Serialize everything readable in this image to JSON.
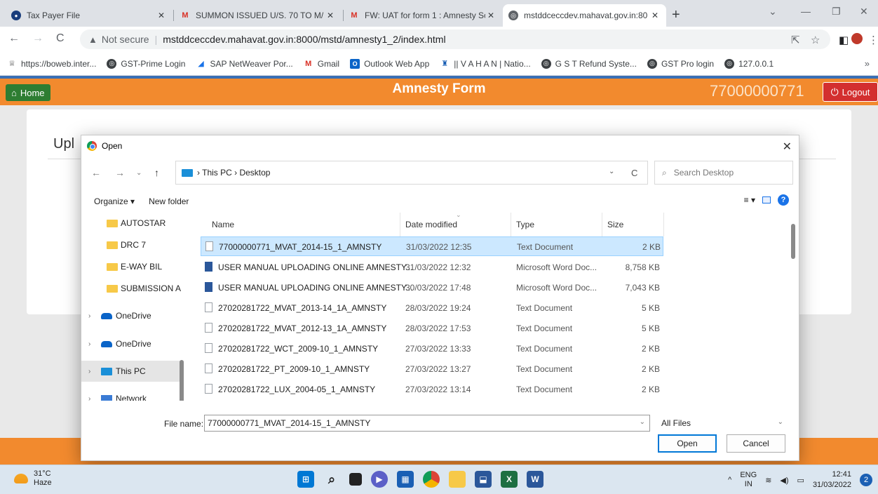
{
  "browser": {
    "tabs": [
      {
        "title": "Tax Payer File",
        "icon": "site-icon",
        "active": false
      },
      {
        "title": "SUMMON ISSUED U/S. 70 TO M/",
        "icon": "gmail-icon",
        "active": false
      },
      {
        "title": "FW: UAT for form 1 : Amnesty Sc",
        "icon": "gmail-icon",
        "active": false
      },
      {
        "title": "mstddceccdev.mahavat.gov.in:80",
        "icon": "globe-icon",
        "active": true
      }
    ],
    "address": {
      "security": "Not secure",
      "url": "mstddceccdev.mahavat.gov.in:8000/mstd/amnesty1_2/index.html"
    },
    "bookmarks": [
      {
        "label": "https://boweb.inter...",
        "icon": "emblem-icon"
      },
      {
        "label": "GST-Prime Login",
        "icon": "globe-icon"
      },
      {
        "label": "SAP NetWeaver Por...",
        "icon": "sap-icon"
      },
      {
        "label": "Gmail",
        "icon": "gmail-icon"
      },
      {
        "label": "Outlook Web App",
        "icon": "outlook-icon"
      },
      {
        "label": "|| V A H A N | Natio...",
        "icon": "vahan-icon"
      },
      {
        "label": "G S T Refund Syste...",
        "icon": "globe-icon"
      },
      {
        "label": "GST Pro login",
        "icon": "globe-icon"
      },
      {
        "label": "127.0.0.1",
        "icon": "globe-icon"
      }
    ]
  },
  "app": {
    "home_label": "Home",
    "title": "Amnesty Form",
    "user_id": "77000000771",
    "logout_label": "Logout",
    "card_title": "Upl",
    "colors": {
      "bar": "#f28a2e",
      "home": "#2e7d32",
      "logout": "#d32f2f"
    }
  },
  "dialog": {
    "title": "Open",
    "breadcrumb": "› This PC › Desktop",
    "search_placeholder": "Search Desktop",
    "organize_label": "Organize ▾",
    "new_folder_label": "New folder",
    "nav_items": [
      {
        "label": "AUTOSTAR",
        "kind": "folder"
      },
      {
        "label": "DRC 7",
        "kind": "folder"
      },
      {
        "label": "E-WAY BIL",
        "kind": "folder"
      },
      {
        "label": "SUBMISSION A",
        "kind": "folder"
      },
      {
        "label": "OneDrive",
        "kind": "cloud"
      },
      {
        "label": "OneDrive",
        "kind": "cloud"
      },
      {
        "label": "This PC",
        "kind": "pc"
      },
      {
        "label": "Network",
        "kind": "network"
      }
    ],
    "columns": {
      "name": "Name",
      "date": "Date modified",
      "type": "Type",
      "size": "Size"
    },
    "files": [
      {
        "name": "77000000771_MVAT_2014-15_1_AMNSTY",
        "date": "31/03/2022 12:35",
        "type": "Text Document",
        "size": "2 KB",
        "kind": "txt"
      },
      {
        "name": "USER MANUAL UPLOADING ONLINE AMNESTY...",
        "date": "31/03/2022 12:32",
        "type": "Microsoft Word Doc...",
        "size": "8,758 KB",
        "kind": "doc"
      },
      {
        "name": "USER MANUAL UPLOADING ONLINE AMNESTY...",
        "date": "30/03/2022 17:48",
        "type": "Microsoft Word Doc...",
        "size": "7,043 KB",
        "kind": "doc"
      },
      {
        "name": "27020281722_MVAT_2013-14_1A_AMNSTY",
        "date": "28/03/2022 19:24",
        "type": "Text Document",
        "size": "5 KB",
        "kind": "txt"
      },
      {
        "name": "27020281722_MVAT_2012-13_1A_AMNSTY",
        "date": "28/03/2022 17:53",
        "type": "Text Document",
        "size": "5 KB",
        "kind": "txt"
      },
      {
        "name": "27020281722_WCT_2009-10_1_AMNSTY",
        "date": "27/03/2022 13:33",
        "type": "Text Document",
        "size": "2 KB",
        "kind": "txt"
      },
      {
        "name": "27020281722_PT_2009-10_1_AMNSTY",
        "date": "27/03/2022 13:27",
        "type": "Text Document",
        "size": "2 KB",
        "kind": "txt"
      },
      {
        "name": "27020281722_LUX_2004-05_1_AMNSTY",
        "date": "27/03/2022 13:14",
        "type": "Text Document",
        "size": "2 KB",
        "kind": "txt"
      }
    ],
    "filename_label": "File name:",
    "filename_value": "77000000771_MVAT_2014-15_1_AMNSTY",
    "filter_value": "All Files",
    "open_label": "Open",
    "cancel_label": "Cancel"
  },
  "taskbar": {
    "temp": "31°C",
    "weather": "Haze",
    "lang1": "ENG",
    "lang2": "IN",
    "time": "12:41",
    "date": "31/03/2022",
    "notifications": "2"
  }
}
